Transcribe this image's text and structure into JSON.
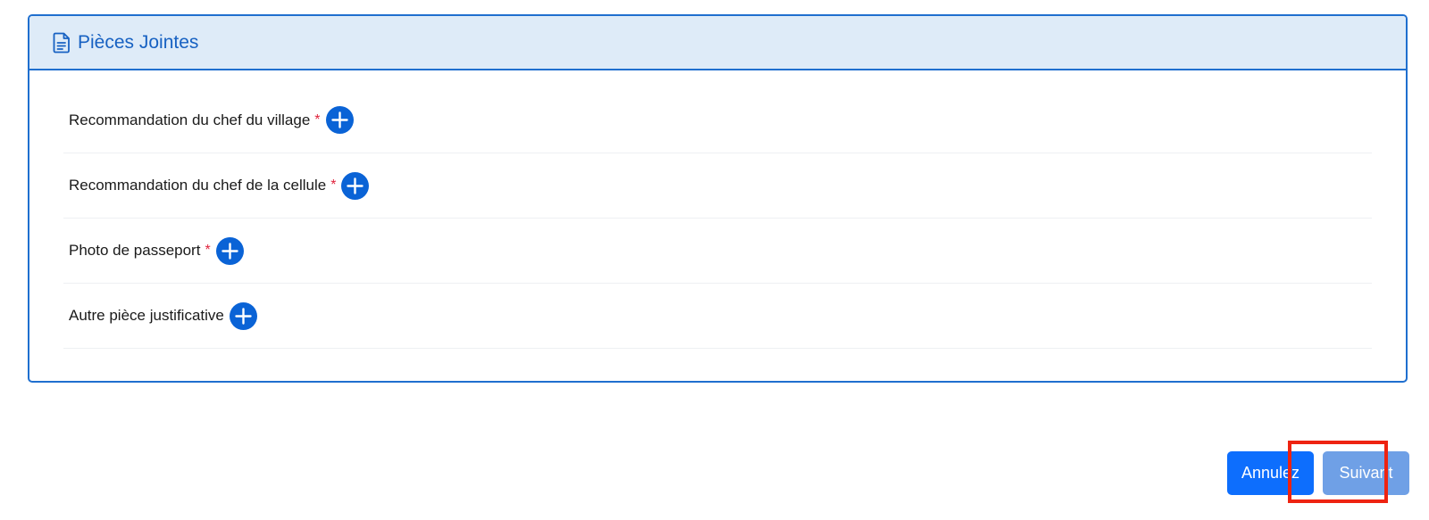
{
  "panel": {
    "title": "Pièces Jointes",
    "icon": "document-icon"
  },
  "attachments": [
    {
      "label": "Recommandation du chef du village",
      "required": "*",
      "action_icon": "plus-circle-icon"
    },
    {
      "label": "Recommandation du chef de la cellule",
      "required": "*",
      "action_icon": "plus-circle-icon"
    },
    {
      "label": "Photo de passeport",
      "required": "*",
      "action_icon": "plus-circle-icon"
    },
    {
      "label": "Autre pièce justificative",
      "required": "",
      "action_icon": "plus-circle-icon"
    }
  ],
  "footer": {
    "cancel_label": "Annulez",
    "next_label": "Suivant"
  },
  "colors": {
    "accent": "#0d6efd",
    "header_bg": "#deebf8",
    "border": "#1f6fcf",
    "required": "#e0243d",
    "highlight": "#ee2311"
  }
}
